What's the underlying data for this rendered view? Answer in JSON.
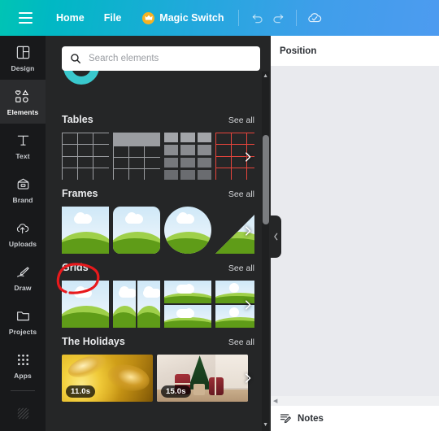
{
  "topbar": {
    "menu_icon": "hamburger-icon",
    "items": [
      {
        "label": "Home",
        "name": "home"
      },
      {
        "label": "File",
        "name": "file"
      },
      {
        "label": "Magic Switch",
        "name": "magic-switch",
        "icon": "crown-icon"
      }
    ],
    "undo_icon": "undo-icon",
    "redo_icon": "redo-icon",
    "save_icon": "cloud-check-icon",
    "gradient_from": "#00c4b4",
    "gradient_to": "#4d9bf0"
  },
  "sidebar": {
    "items": [
      {
        "label": "Design",
        "icon": "design-icon",
        "active": false
      },
      {
        "label": "Elements",
        "icon": "elements-icon",
        "active": true
      },
      {
        "label": "Text",
        "icon": "text-icon",
        "active": false
      },
      {
        "label": "Brand",
        "icon": "brand-icon",
        "active": false
      },
      {
        "label": "Uploads",
        "icon": "uploads-icon",
        "active": false
      },
      {
        "label": "Draw",
        "icon": "draw-icon",
        "active": false
      },
      {
        "label": "Projects",
        "icon": "projects-icon",
        "active": false
      },
      {
        "label": "Apps",
        "icon": "apps-icon",
        "active": false
      }
    ],
    "active_color": "#ffffff",
    "inactive_color": "#c9ccd0",
    "background": "#18191b"
  },
  "panel": {
    "search": {
      "placeholder": "Search elements",
      "value": "",
      "icon": "search-icon"
    },
    "see_all_label": "See all",
    "next_arrow_icon": "chevron-right-icon",
    "collapse_icon": "chevron-left-icon",
    "sections": [
      {
        "title": "Tables",
        "see_all": "See all"
      },
      {
        "title": "Frames",
        "see_all": "See all"
      },
      {
        "title": "Grids",
        "see_all": "See all",
        "annotated": true
      },
      {
        "title": "The Holidays",
        "see_all": "See all"
      }
    ],
    "holidays": [
      {
        "duration": "11.0s",
        "name": "gold-ribbon-video"
      },
      {
        "duration": "15.0s",
        "name": "christmas-family-video"
      }
    ],
    "background": "#252627"
  },
  "annotation": {
    "target": "Grids",
    "color": "#e8191c",
    "shape": "hand-drawn-circle"
  },
  "editor": {
    "position_label": "Position",
    "notes_label": "Notes",
    "notes_icon": "notes-icon",
    "canvas_background": "#e9eaee"
  }
}
